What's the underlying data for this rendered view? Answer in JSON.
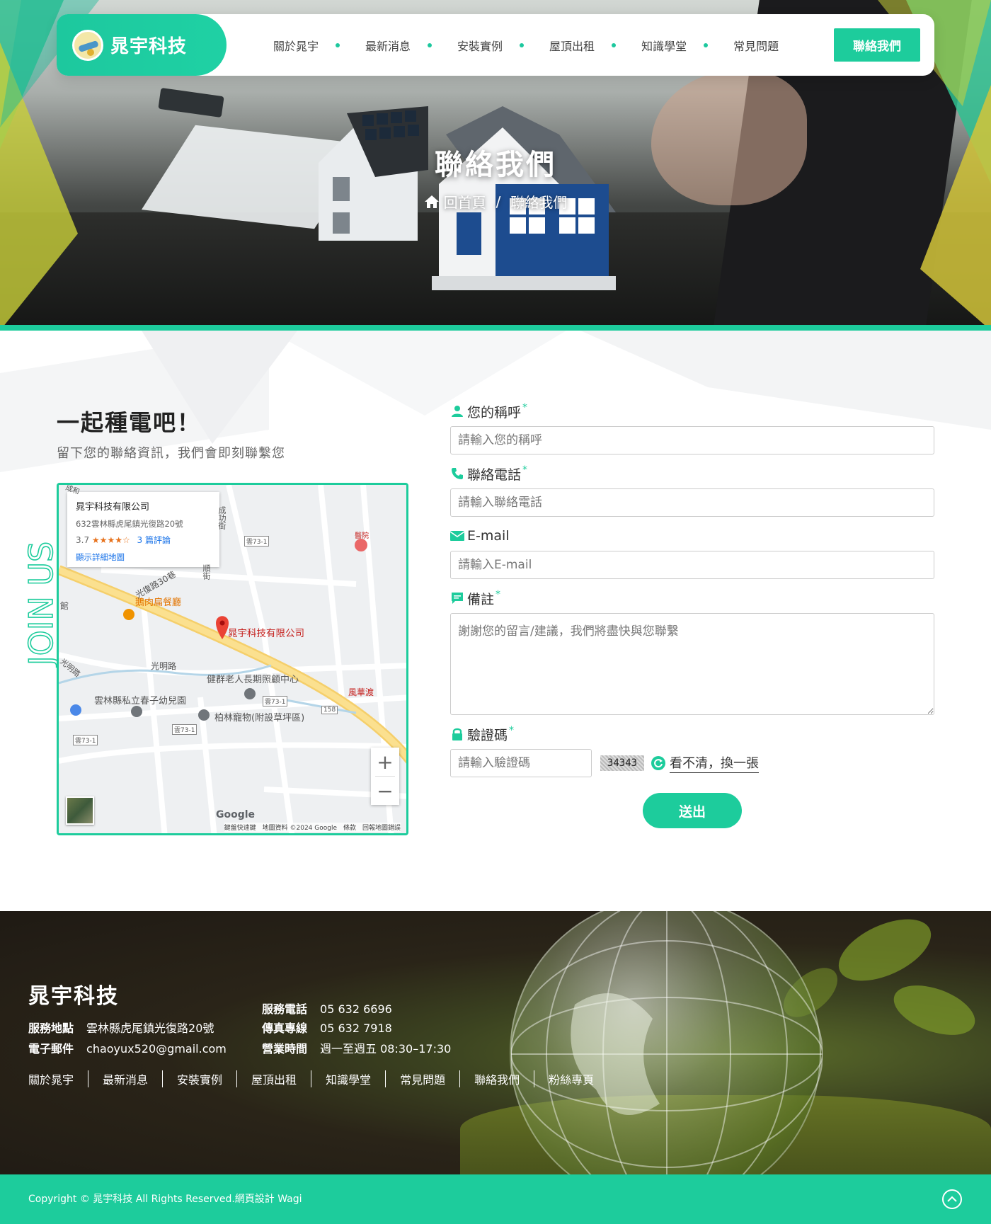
{
  "nav": {
    "brand": "晁宇科技",
    "links": [
      "關於晁宇",
      "最新消息",
      "安裝實例",
      "屋頂出租",
      "知識學堂",
      "常見問題"
    ],
    "cta": "聯絡我們"
  },
  "hero": {
    "title": "聯絡我們",
    "breadcrumb_home": "回首頁",
    "breadcrumb_sep": "/",
    "breadcrumb_current": "聯絡我們"
  },
  "contact": {
    "side_text": "JOIN US",
    "heading": "一起種電吧！",
    "subheading": "留下您的聯絡資訊，我們會即刻聯繫您"
  },
  "map": {
    "card_title": "晁宇科技有限公司",
    "card_address": "632雲林縣虎尾鎮光復路20號",
    "card_rating": "3.7",
    "card_stars": "★★★★☆",
    "card_reviews": "3 篇評論",
    "card_link": "顯示詳細地圖",
    "labels": {
      "company": "晁宇科技有限公司",
      "restaurant": "鵝肉扁餐廳",
      "road1": "光復路30巷",
      "road2": "光明路",
      "road3": "光明路",
      "care": "健群老人長期照顧中心",
      "kinder": "雲林縣私立春子幼兒園",
      "pet": "柏林寵物(附設草坪區)",
      "hospital": "醫院",
      "ferry": "風華渡",
      "lib": "館",
      "street1": "成功街",
      "street2": "順街",
      "r1": "雲73-1",
      "r2": "雲73-1",
      "r3": "雲73-1",
      "r4": "雲73-1",
      "r5": "158",
      "top": "成和"
    },
    "zoom_in": "+",
    "zoom_out": "−",
    "google": "Google",
    "footer_text": "鍵盤快速鍵　地圖資料 ©2024 Google　條款　回報地圖錯誤"
  },
  "form": {
    "name_label": "您的稱呼",
    "name_placeholder": "請輸入您的稱呼",
    "phone_label": "聯絡電話",
    "phone_placeholder": "請輸入聯絡電話",
    "email_label": "E-mail",
    "email_placeholder": "請輸入E-mail",
    "note_label": "備註",
    "note_placeholder": "謝謝您的留言/建議，我們將盡快與您聯繫",
    "captcha_label": "驗證碼",
    "captcha_placeholder": "請輸入驗證碼",
    "captcha_code": "34343",
    "captcha_refresh": "看不清，換一張",
    "required_mark": "*",
    "submit": "送出"
  },
  "footer": {
    "brand": "晁宇科技",
    "address_label": "服務地點",
    "address": "雲林縣虎尾鎮光復路20號",
    "email_label": "電子郵件",
    "email": "chaoyux520@gmail.com",
    "phone_label": "服務電話",
    "phone": "05 632 6696",
    "fax_label": "傳真專線",
    "fax": "05 632 7918",
    "hours_label": "營業時間",
    "hours": "週一至週五 08:30–17:30",
    "links": [
      "關於晁宇",
      "最新消息",
      "安裝實例",
      "屋頂出租",
      "知識學堂",
      "常見問題",
      "聯絡我們",
      "粉絲專頁"
    ],
    "copyright": "Copyright © 晁宇科技 All Rights Reserved.網頁設計 Wagi"
  },
  "colors": {
    "accent": "#1dcc9c",
    "text": "#333333"
  }
}
